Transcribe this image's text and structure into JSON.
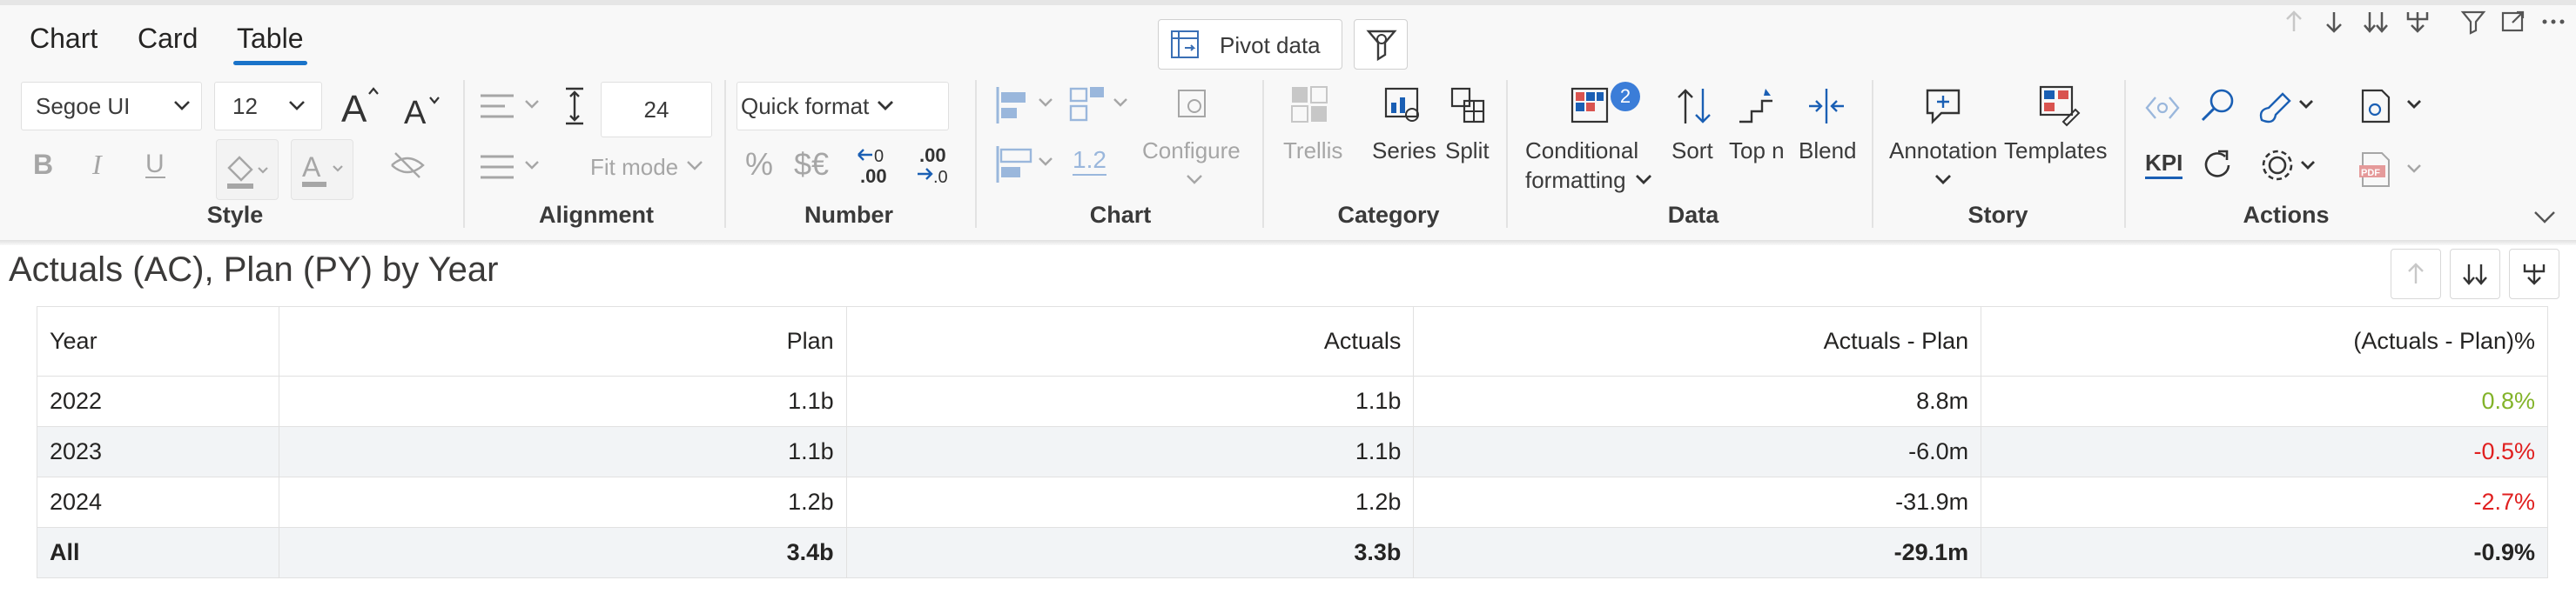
{
  "tabs": [
    {
      "label": "Chart"
    },
    {
      "label": "Card"
    },
    {
      "label": "Table"
    }
  ],
  "header_buttons": {
    "pivot_data": "Pivot data"
  },
  "style": {
    "font_family": "Segoe UI",
    "font_size": "12",
    "group_label": "Style"
  },
  "alignment": {
    "row_height": "24",
    "fit_mode": "Fit mode",
    "group_label": "Alignment"
  },
  "number": {
    "quick_format": "Quick format",
    "percent": "%",
    "currency": "$€",
    "decrease_decimals": "←0\n.00",
    "increase_decimals": ".00\n→.0",
    "group_label": "Number"
  },
  "chart": {
    "scale_value": "1.2",
    "configure": "Configure",
    "group_label": "Chart"
  },
  "category": {
    "trellis": "Trellis",
    "series": "Series",
    "split": "Split",
    "group_label": "Category"
  },
  "data": {
    "conditional_formatting_line1": "Conditional",
    "conditional_formatting_line2": "formatting",
    "badge": "2",
    "sort": "Sort",
    "top_n": "Top n",
    "blend": "Blend",
    "group_label": "Data"
  },
  "story": {
    "annotation": "Annotation",
    "templates": "Templates",
    "group_label": "Story"
  },
  "actions": {
    "kpi": "KPI",
    "group_label": "Actions"
  },
  "visual": {
    "title": "Actuals (AC), Plan (PY) by Year"
  },
  "table": {
    "columns": [
      "Year",
      "Plan",
      "Actuals",
      "Actuals - Plan",
      "(Actuals - Plan)%"
    ],
    "rows": [
      {
        "year": "2022",
        "plan": "1.1b",
        "actuals": "1.1b",
        "diff": "8.8m",
        "pct": "0.8%",
        "pct_sign": "pos"
      },
      {
        "year": "2023",
        "plan": "1.1b",
        "actuals": "1.1b",
        "diff": "-6.0m",
        "pct": "-0.5%",
        "pct_sign": "neg"
      },
      {
        "year": "2024",
        "plan": "1.2b",
        "actuals": "1.2b",
        "diff": "-31.9m",
        "pct": "-2.7%",
        "pct_sign": "neg"
      }
    ],
    "total": {
      "year": "All",
      "plan": "3.4b",
      "actuals": "3.3b",
      "diff": "-29.1m",
      "pct": "-0.9%"
    }
  },
  "colors": {
    "accent": "#1a73c9",
    "positive": "#83b32a",
    "negative": "#e02020",
    "badge": "#3b7dd8"
  }
}
